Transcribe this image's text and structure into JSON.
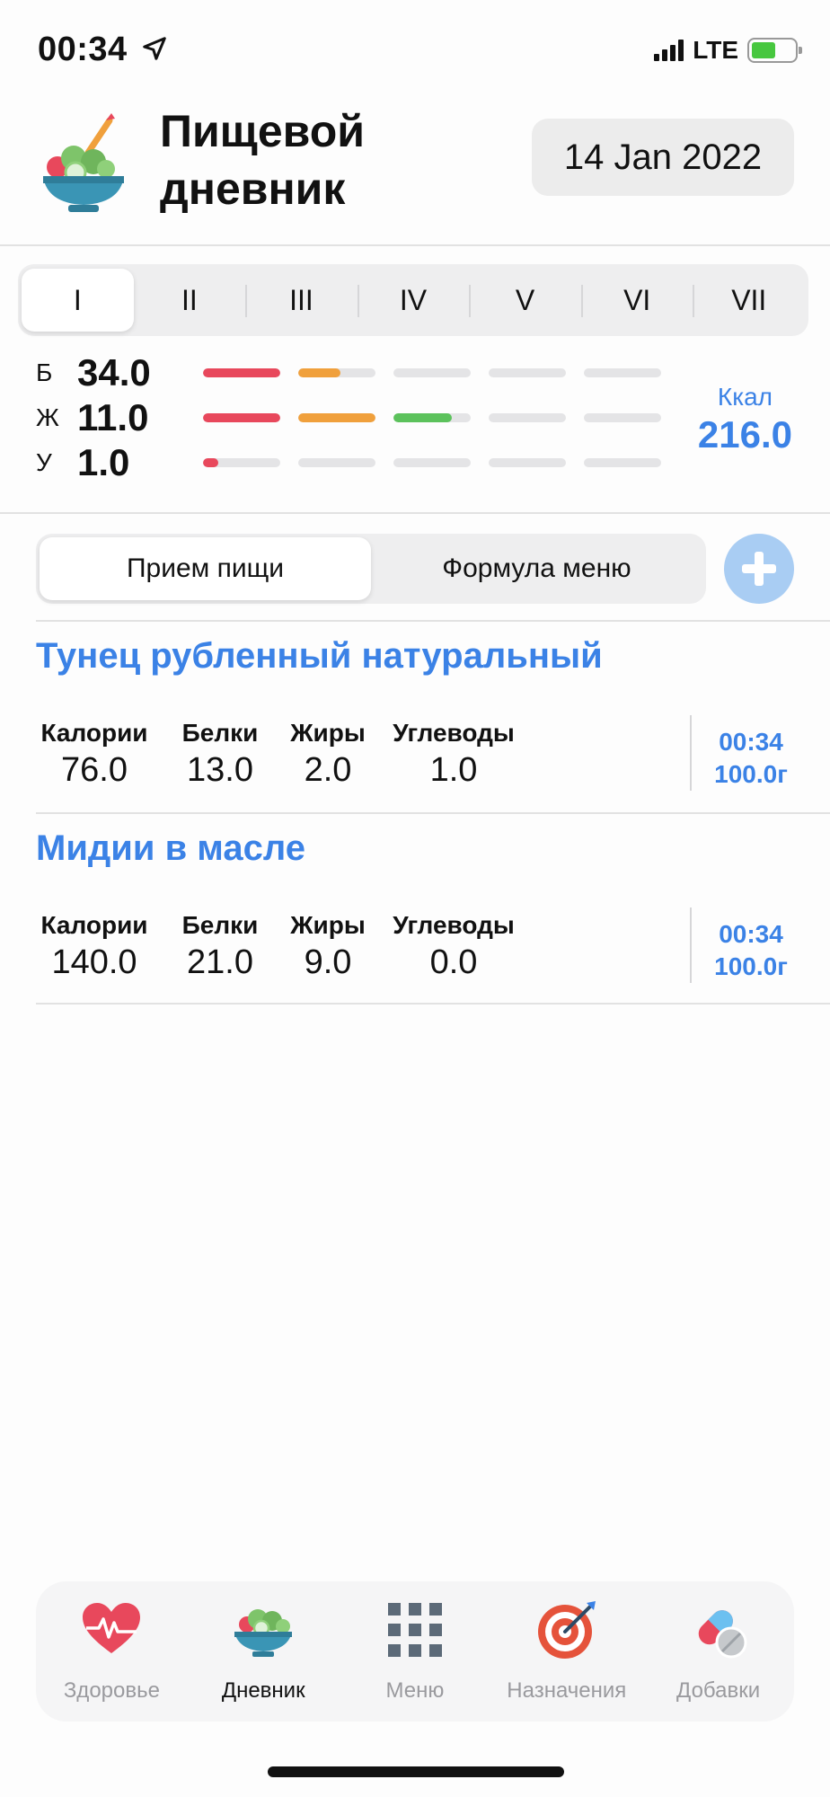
{
  "status_bar": {
    "time": "00:34",
    "network": "LTE"
  },
  "header": {
    "title": "Пищевой дневник",
    "date": "14 Jan 2022"
  },
  "meal_segments": [
    {
      "label": "I",
      "active": true
    },
    {
      "label": "II",
      "active": false
    },
    {
      "label": "III",
      "active": false
    },
    {
      "label": "IV",
      "active": false
    },
    {
      "label": "V",
      "active": false
    },
    {
      "label": "VI",
      "active": false
    },
    {
      "label": "VII",
      "active": false
    }
  ],
  "macros": {
    "rows": [
      {
        "letter": "Б",
        "value": "34.0",
        "bar_fills": [
          1.0,
          0.55,
          0,
          0,
          0
        ]
      },
      {
        "letter": "Ж",
        "value": "11.0",
        "bar_fills": [
          1.0,
          1.0,
          0.75,
          0,
          0
        ]
      },
      {
        "letter": "У",
        "value": "1.0",
        "bar_fills": [
          0.2,
          0,
          0,
          0,
          0
        ]
      }
    ],
    "bar_colors": [
      "#e8485c",
      "#f0a03c",
      "#5cc25c",
      "#e4e4e6",
      "#e4e4e6"
    ],
    "kcal_label": "Ккал",
    "kcal_value": "216.0"
  },
  "view_toggle": {
    "options": [
      "Прием пищи",
      "Формула меню"
    ],
    "active_index": 0
  },
  "entries": [
    {
      "name": "Тунец рубленный натуральный",
      "labels": {
        "calories": "Калории",
        "protein": "Белки",
        "fat": "Жиры",
        "carbs": "Углеводы"
      },
      "calories": "76.0",
      "protein": "13.0",
      "fat": "2.0",
      "carbs": "1.0",
      "time": "00:34",
      "weight": "100.0г"
    },
    {
      "name": "Мидии в масле",
      "labels": {
        "calories": "Калории",
        "protein": "Белки",
        "fat": "Жиры",
        "carbs": "Углеводы"
      },
      "calories": "140.0",
      "protein": "21.0",
      "fat": "9.0",
      "carbs": "0.0",
      "time": "00:34",
      "weight": "100.0г"
    }
  ],
  "tabbar": {
    "items": [
      {
        "label": "Здоровье",
        "icon": "heart-pulse-icon",
        "active": false
      },
      {
        "label": "Дневник",
        "icon": "salad-bowl-icon",
        "active": true
      },
      {
        "label": "Меню",
        "icon": "grid-icon",
        "active": false
      },
      {
        "label": "Назначения",
        "icon": "target-icon",
        "active": false
      },
      {
        "label": "Добавки",
        "icon": "pills-icon",
        "active": false
      }
    ]
  },
  "colors": {
    "accent": "#3b82e6",
    "protein_bar": "#e8485c",
    "fat_bar": "#f0a03c",
    "carb_bar": "#5cc25c"
  }
}
